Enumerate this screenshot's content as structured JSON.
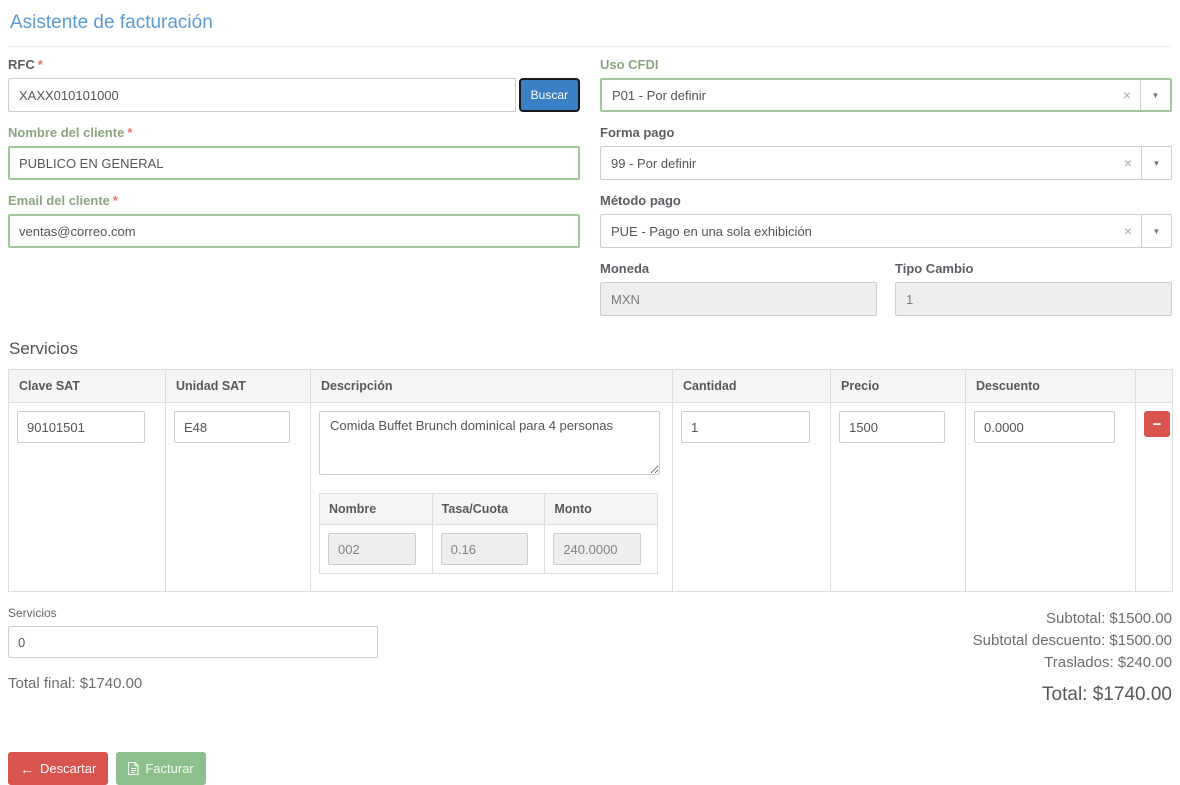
{
  "page": {
    "title": "Asistente de facturación"
  },
  "colors": {
    "title_blue": "#5b9bd5",
    "primary_button_blue": "#3b7fc4",
    "success_green_border": "#9fc79a",
    "success_green_label": "#8ba57f",
    "danger_red": "#d9534f",
    "invoice_button_green": "#8cbf8c",
    "required_mark_red": "#ec7063"
  },
  "icons": {
    "clear": "×",
    "caret_down": "▼",
    "minus": "−",
    "arrow_left": "←"
  },
  "customer": {
    "rfc": {
      "label": "RFC",
      "required_mark": "*",
      "value": "XAXX010101000",
      "search_button": "Buscar"
    },
    "name": {
      "label": "Nombre del cliente",
      "required_mark": "*",
      "value": "PUBLICO EN GENERAL"
    },
    "email": {
      "label": "Email del cliente",
      "required_mark": "*",
      "value": "ventas@correo.com"
    }
  },
  "payment": {
    "uso_cfdi": {
      "label": "Uso CFDI",
      "selected": "P01 - Por definir"
    },
    "forma_pago": {
      "label": "Forma pago",
      "selected": "99 - Por definir"
    },
    "metodo_pago": {
      "label": "Método pago",
      "selected": "PUE - Pago en una sola exhibición"
    },
    "moneda": {
      "label": "Moneda",
      "value": "MXN"
    },
    "tipo_cambio": {
      "label": "Tipo Cambio",
      "value": "1"
    }
  },
  "services": {
    "heading": "Servicios",
    "columns": [
      "Clave SAT",
      "Unidad SAT",
      "Descripción",
      "Cantidad",
      "Precio",
      "Descuento"
    ],
    "rows": [
      {
        "clave_sat": "90101501",
        "unidad_sat": "E48",
        "descripcion": "Comida Buffet Brunch dominical para 4 personas",
        "cantidad": "1",
        "precio": "1500",
        "descuento": "0.0000",
        "taxes": {
          "columns": [
            "Nombre",
            "Tasa/Cuota",
            "Monto"
          ],
          "rows": [
            {
              "nombre": "002",
              "tasa_cuota": "0.16",
              "monto": "240.0000"
            }
          ]
        }
      }
    ]
  },
  "summary": {
    "services_label": "Servicios",
    "services_value": "0",
    "total_final": "Total final: $1740.00",
    "subtotal": "Subtotal: $1500.00",
    "subtotal_descuento": "Subtotal descuento: $1500.00",
    "traslados": "Traslados: $240.00",
    "total": "Total: $1740.00"
  },
  "actions": {
    "discard": "Descartar",
    "invoice": "Facturar"
  }
}
